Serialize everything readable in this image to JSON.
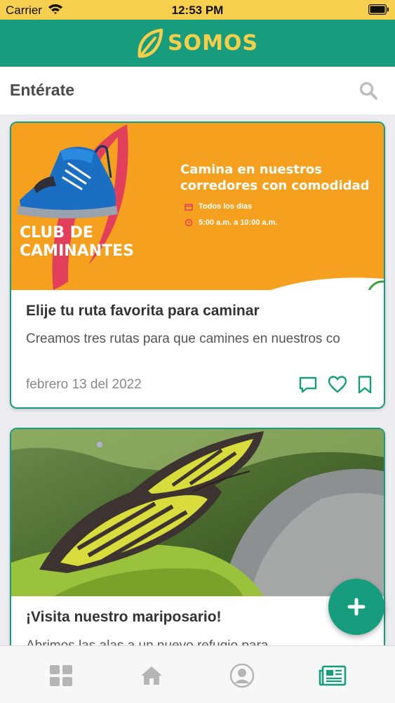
{
  "status_bar": {
    "carrier": "Carrier",
    "time": "12:53 PM"
  },
  "app": {
    "logo_text": "SOMOS"
  },
  "section": {
    "title": "Entérate"
  },
  "cards": [
    {
      "banner": {
        "club_line1": "CLUB DE",
        "club_line2": "CAMINANTES",
        "headline_line1": "Camina en nuestros",
        "headline_line2": "corredores con comodidad",
        "info_days": "Todos los días",
        "info_hours": "5:00 a.m. a 10:00 a.m."
      },
      "title": "Elije tu ruta favorita para caminar",
      "description": "Creamos tres rutas para que camines en nuestros co",
      "date": "febrero 13 del 2022"
    },
    {
      "title": "¡Visita nuestro mariposario!",
      "description": "Abrimos las alas a un nuevo refugio para"
    }
  ],
  "tabs": [
    "dashboard",
    "home",
    "profile",
    "news"
  ],
  "colors": {
    "primary": "#179d7d",
    "accent": "#f5cf4a",
    "banner": "#f5a11f"
  },
  "icons": [
    "wifi-icon",
    "battery-icon",
    "leaf-logo-icon",
    "search-icon",
    "calendar-icon",
    "clock-icon",
    "comment-icon",
    "heart-icon",
    "bookmark-icon",
    "plus-icon",
    "grid-icon",
    "home-icon",
    "user-icon",
    "newspaper-icon"
  ]
}
